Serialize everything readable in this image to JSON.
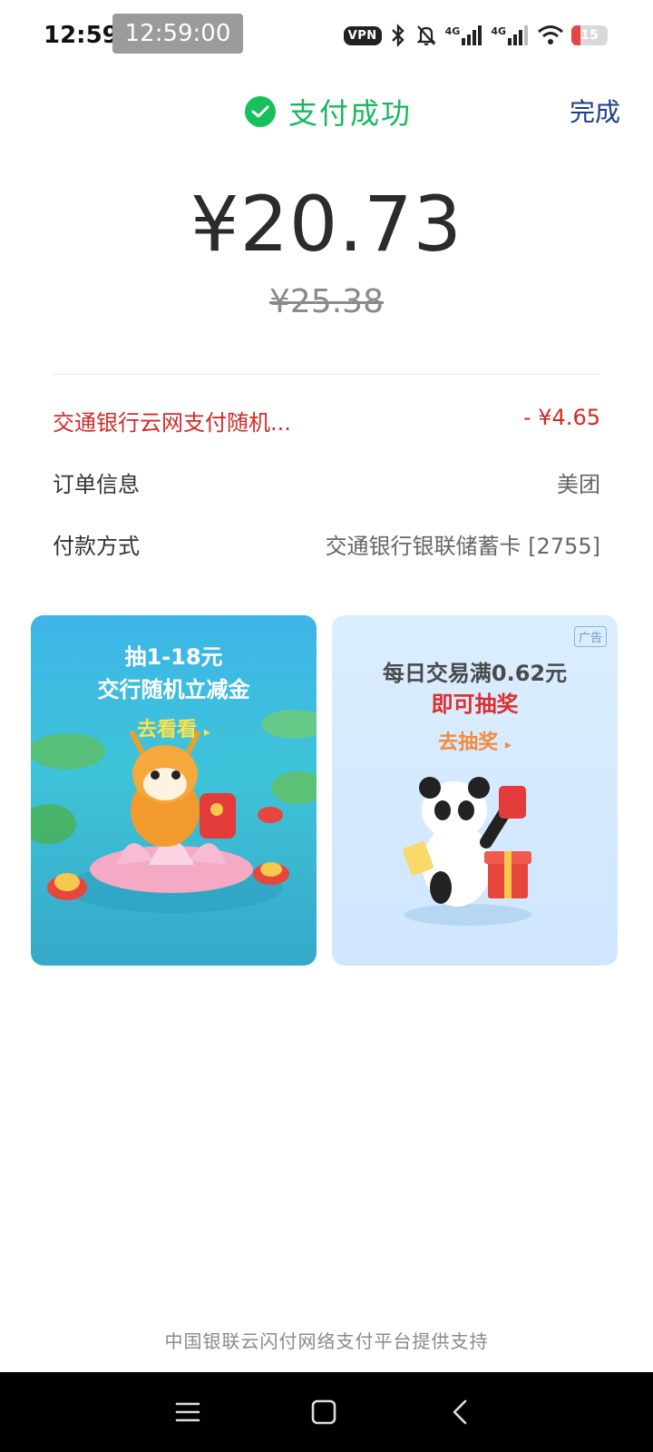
{
  "status_bar": {
    "time": "12:59",
    "time_chip": "12:59:00",
    "vpn_label": "VPN",
    "network_labels": [
      "4G",
      "4G"
    ],
    "battery_level": "15",
    "icons": [
      "vpn-icon",
      "bluetooth-icon",
      "mute-icon",
      "signal-4g-icon",
      "signal-4g-icon",
      "wifi-icon",
      "battery-icon"
    ]
  },
  "header": {
    "title": "支付成功",
    "done_label": "完成",
    "check_icon": "check-circle-icon",
    "accent_color": "#18c05c"
  },
  "payment": {
    "amount": "¥20.73",
    "original_amount": "¥25.38"
  },
  "details": {
    "discount": {
      "label": "交通银行云网支付随机...",
      "value": "- ¥4.65"
    },
    "order": {
      "label": "订单信息",
      "value": "美团"
    },
    "method": {
      "label": "付款方式",
      "value": "交通银行银联储蓄卡 [2755]"
    }
  },
  "promos": {
    "left": {
      "line1": "抽1-18元",
      "line2": "交行随机立减金",
      "cta": "去看看",
      "arrow": "▸"
    },
    "right": {
      "ad_badge": "广告",
      "line1": "每日交易满0.62元",
      "line2": "即可抽奖",
      "cta": "去抽奖",
      "arrow": "▸"
    }
  },
  "footer": {
    "text": "中国银联云闪付网络支付平台提供支持"
  },
  "nav": {
    "icons": [
      "menu-icon",
      "home-icon",
      "back-icon"
    ]
  }
}
